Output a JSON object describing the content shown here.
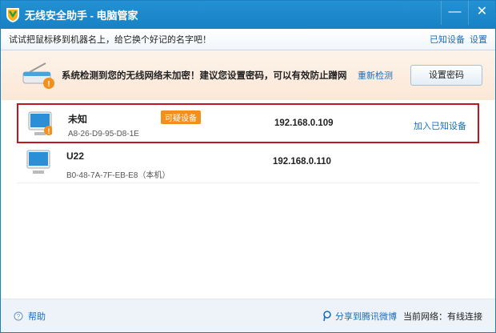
{
  "window": {
    "title": "无线安全助手 - 电脑管家",
    "minimize": "—",
    "close": "✕"
  },
  "subbar": {
    "hint": "试试把鼠标移到机器名上，给它换个好记的名字吧！",
    "known_devices": "已知设备",
    "settings": "设置"
  },
  "warning": {
    "message": "系统检测到您的无线网络未加密！建议您设置密码，可以有效防止蹭网",
    "recheck": "重新检测",
    "set_password": "设置密码"
  },
  "devices": [
    {
      "name": "未知",
      "mac": "A8-26-D9-95-D8-1E",
      "badge": "可疑设备",
      "ip": "192.168.0.109",
      "action": "加入已知设备"
    },
    {
      "name": "U22",
      "mac": "B0-48-7A-7F-EB-E8（本机）",
      "ip": "192.168.0.110"
    }
  ],
  "footer": {
    "help": "帮助",
    "share": "分享到腾讯微博",
    "network": "当前网络：有线连接"
  }
}
